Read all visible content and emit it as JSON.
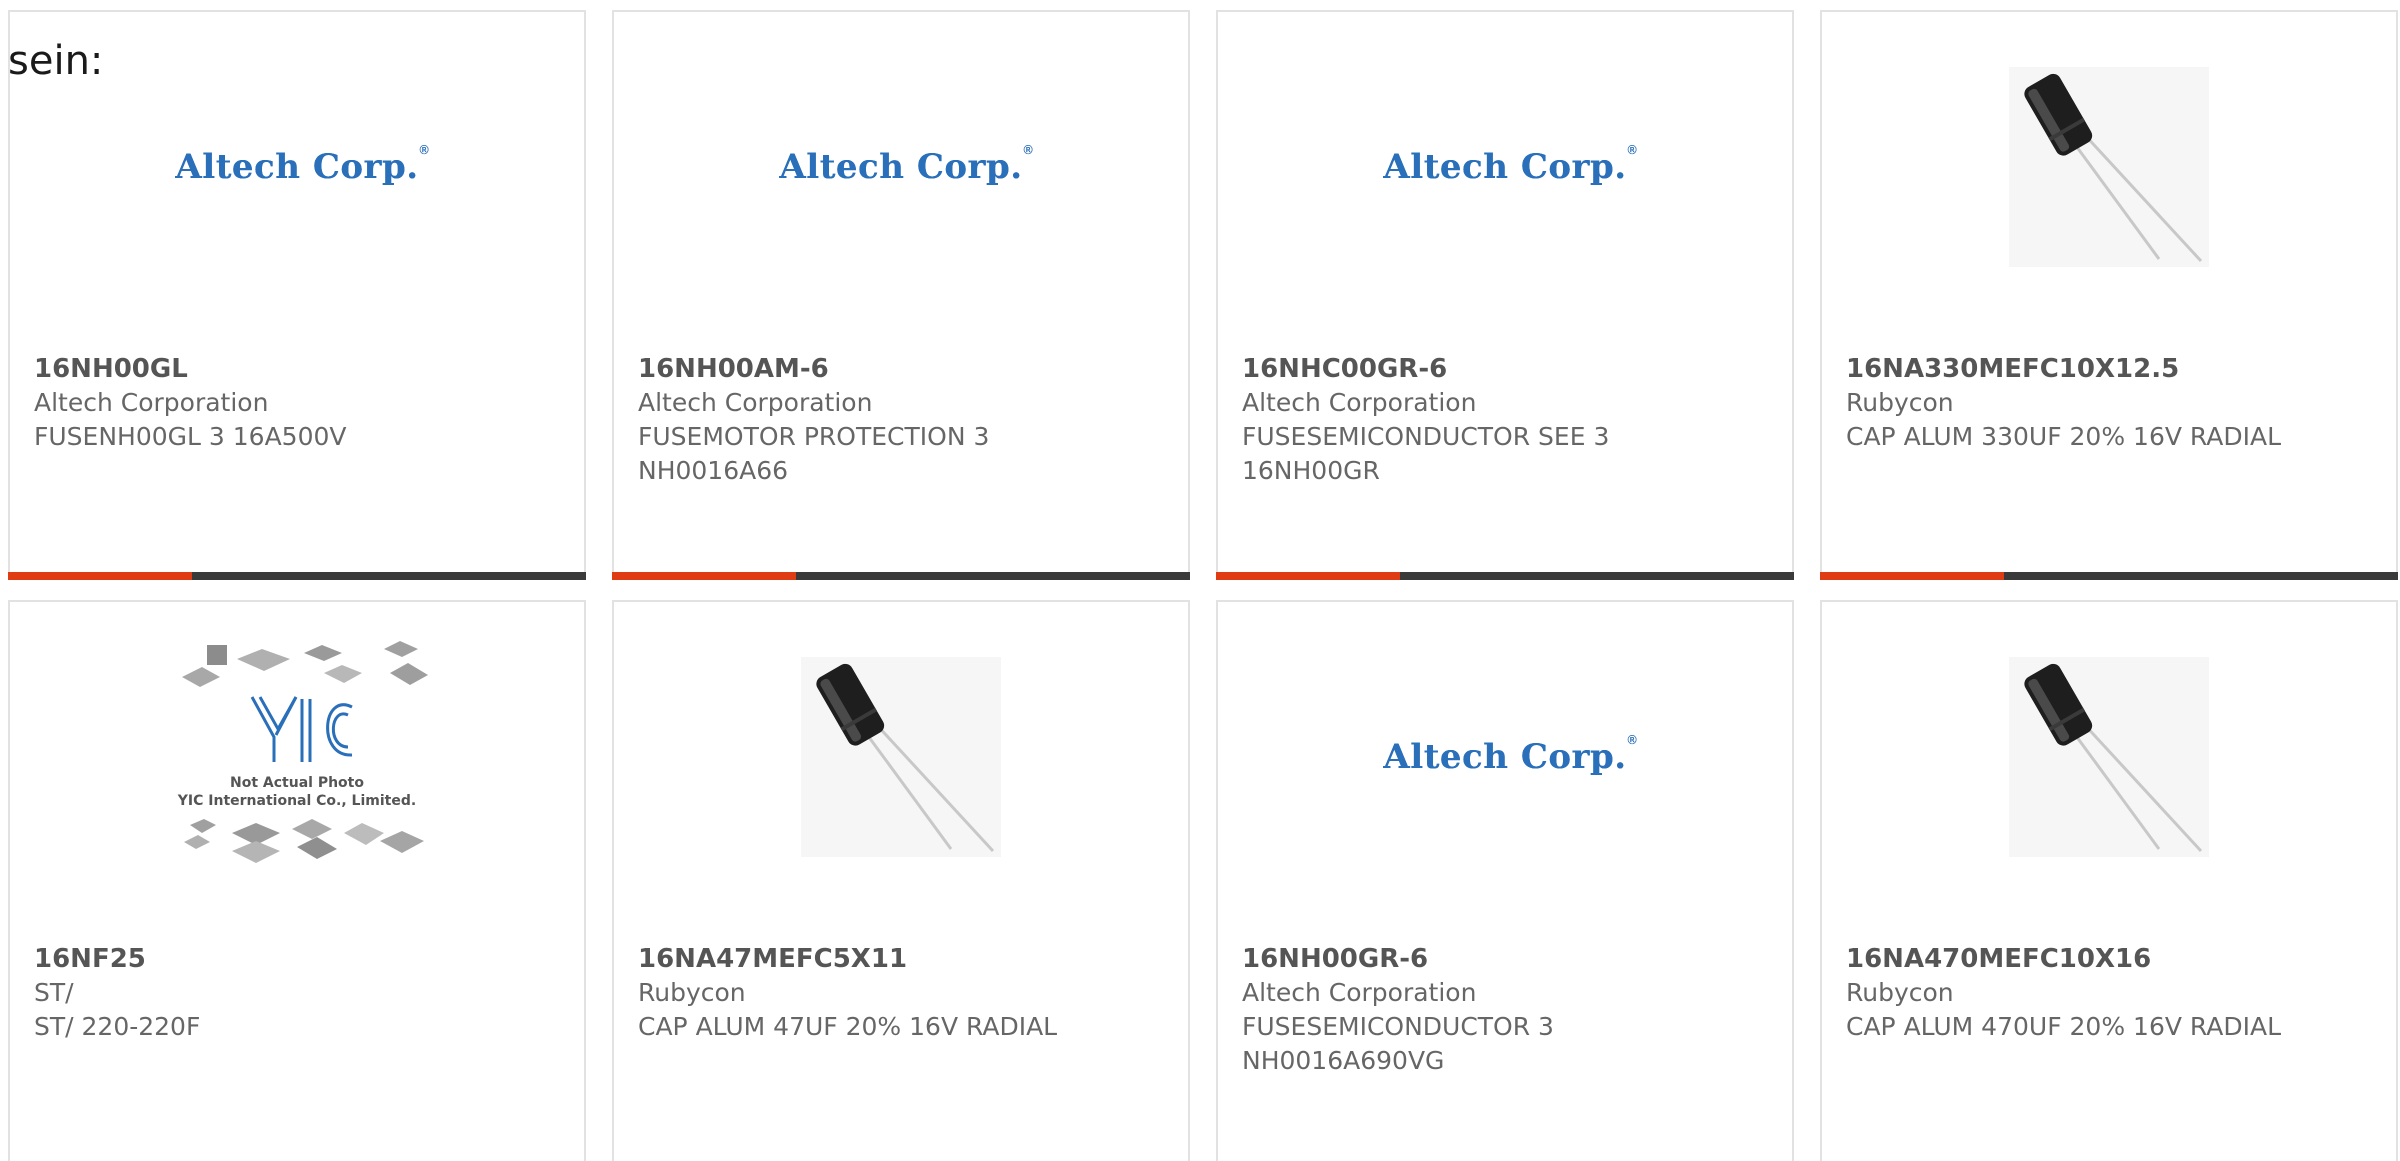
{
  "stray_text": "sein:",
  "colors": {
    "accent": "#e03c14",
    "bar": "#3a3a3a",
    "logo_blue": "#2a6fb9"
  },
  "cards": [
    {
      "part_number": "16NH00GL",
      "manufacturer": "Altech Corporation",
      "description": "FUSENH00GL 3 16A500V",
      "image": "altech-logo",
      "logo_text": "Altech Corp."
    },
    {
      "part_number": "16NH00AM-6",
      "manufacturer": "Altech Corporation",
      "description": "FUSEMOTOR PROTECTION 3 NH0016A66",
      "image": "altech-logo",
      "logo_text": "Altech Corp."
    },
    {
      "part_number": "16NHC00GR-6",
      "manufacturer": "Altech Corporation",
      "description": "FUSESEMICONDUCTOR SEE 3 16NH00GR",
      "image": "altech-logo",
      "logo_text": "Altech Corp."
    },
    {
      "part_number": "16NA330MEFC10X12.5",
      "manufacturer": "Rubycon",
      "description": "CAP ALUM 330UF 20% 16V RADIAL",
      "image": "capacitor-photo"
    },
    {
      "part_number": "16NF25",
      "manufacturer": "ST/",
      "description": "ST/ 220-220F",
      "image": "yic-placeholder",
      "placeholder_line1": "Not Actual Photo",
      "placeholder_line2": "YIC International Co., Limited."
    },
    {
      "part_number": "16NA47MEFC5X11",
      "manufacturer": "Rubycon",
      "description": "CAP ALUM 47UF 20% 16V RADIAL",
      "image": "capacitor-photo"
    },
    {
      "part_number": "16NH00GR-6",
      "manufacturer": "Altech Corporation",
      "description": "FUSESEMICONDUCTOR 3 NH0016A690VG",
      "image": "altech-logo",
      "logo_text": "Altech Corp."
    },
    {
      "part_number": "16NA470MEFC10X16",
      "manufacturer": "Rubycon",
      "description": "CAP ALUM 470UF 20% 16V RADIAL",
      "image": "capacitor-photo"
    }
  ]
}
